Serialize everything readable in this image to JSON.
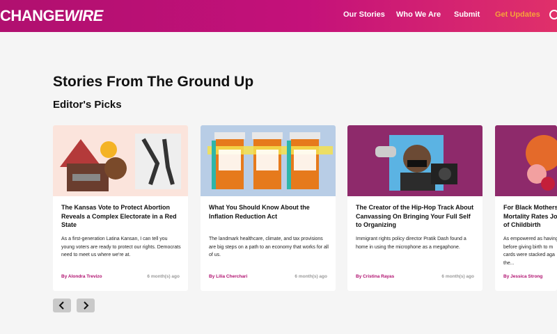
{
  "header": {
    "logo_part1": "CHANGE",
    "logo_part2": "WIRE",
    "nav": [
      {
        "label": "Our Stories"
      },
      {
        "label": "Who We Are"
      },
      {
        "label": "Submit"
      },
      {
        "label": "Get Updates"
      }
    ],
    "search_icon": "search-icon"
  },
  "main": {
    "page_title": "Stories From The Ground Up",
    "section_title": "Editor's Picks",
    "cards": [
      {
        "title": "The Kansas Vote to Protect Abortion Reveals a Complex Electorate in a Red State",
        "excerpt": "As a first-generation Latina Kansan, I can tell you young voters are ready to protect our rights. Democrats need to meet us where we're at.",
        "author": "By Alondra Trevizo",
        "time": "6 month(s) ago"
      },
      {
        "title": "What You Should Know About the Inflation Reduction Act",
        "excerpt": "The landmark healthcare, climate, and tax provisions are big steps on a path to an economy that works for all of us.",
        "author": "By Lilia Cherchari",
        "time": "6 month(s) ago"
      },
      {
        "title": "The Creator of the Hip-Hop Track About Canvassing On Bringing Your Full Self to Organizing",
        "excerpt": "Immigrant rights policy director Pratik Dash found a home in using the microphone as a megaphone.",
        "author": "By Cristina Rayas",
        "time": "6 month(s) ago"
      },
      {
        "title": "For Black Mothers of Mortality Rates Joy of Childbirth",
        "excerpt": "As empowered as having before giving birth to m cards were stacked aga the...",
        "author": "By Jessica Strong",
        "time": ""
      }
    ]
  },
  "colors": {
    "accent": "#b0106f",
    "updates": "#f6a23a"
  }
}
